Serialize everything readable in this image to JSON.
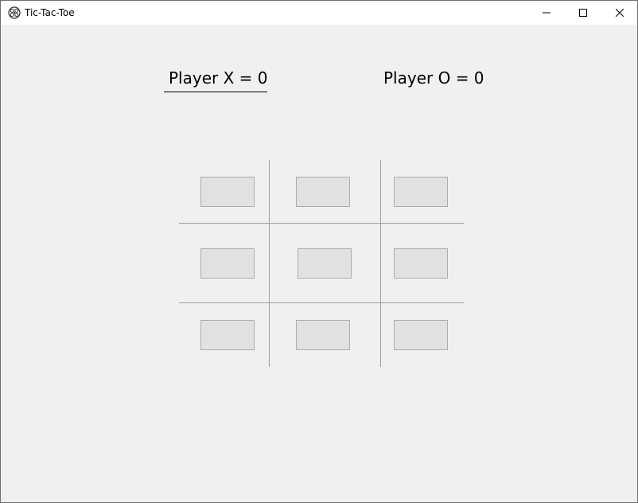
{
  "window": {
    "title": "Tic-Tac-Toe",
    "icon": "tic-tac-toe-app-icon",
    "controls": [
      "minimize-icon",
      "maximize-icon",
      "close-icon"
    ]
  },
  "scores": {
    "player_x": "Player X = 0",
    "player_o": "Player O = 0"
  },
  "board": {
    "cells": [
      "",
      "",
      "",
      "",
      "",
      "",
      "",
      "",
      ""
    ]
  },
  "colors": {
    "background": "#f0f0f0",
    "button_face": "#e1e1e1",
    "button_border": "#adadad",
    "grid_line": "#a0a0a0"
  }
}
